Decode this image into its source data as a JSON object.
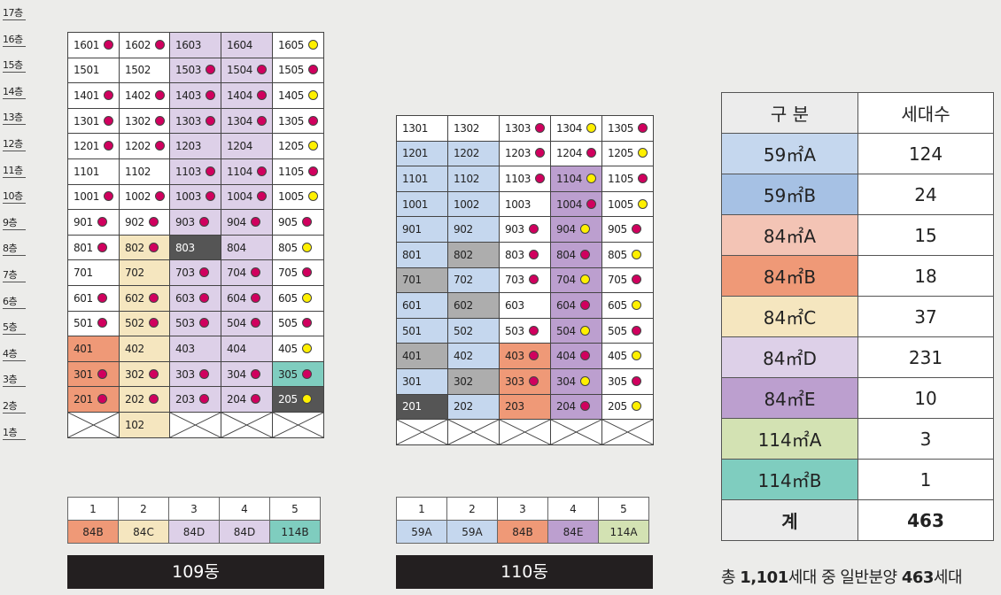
{
  "colors": {
    "59A": "#c5d7ee",
    "59B": "#a6c1e4",
    "84A": "#f3c4b5",
    "84B": "#ef9977",
    "84C": "#f5e6bf",
    "84D": "#ddd0e8",
    "84E": "#bc9fcf",
    "114A": "#d3e2b3",
    "114B": "#7fcdbf",
    "white": "#ffffff",
    "gray": "#adadad",
    "dark": "#555555",
    "header_bg": "#ececec"
  },
  "floors": [
    "17층",
    "16층",
    "15층",
    "14층",
    "13층",
    "12층",
    "11층",
    "10층",
    "9층",
    "8층",
    "7층",
    "6층",
    "5층",
    "4층",
    "3층",
    "2층",
    "1층"
  ],
  "building_109": {
    "name": "109동",
    "rows": [
      [
        [
          "1601",
          "white",
          "m"
        ],
        [
          "1602",
          "white",
          "m"
        ],
        [
          "1603",
          "84D",
          ""
        ],
        [
          "1604",
          "84D",
          ""
        ],
        [
          "1605",
          "white",
          "y"
        ]
      ],
      [
        [
          "1501",
          "white",
          ""
        ],
        [
          "1502",
          "white",
          ""
        ],
        [
          "1503",
          "84D",
          "m"
        ],
        [
          "1504",
          "84D",
          "m"
        ],
        [
          "1505",
          "white",
          "m"
        ]
      ],
      [
        [
          "1401",
          "white",
          "m"
        ],
        [
          "1402",
          "white",
          "m"
        ],
        [
          "1403",
          "84D",
          "m"
        ],
        [
          "1404",
          "84D",
          "m"
        ],
        [
          "1405",
          "white",
          "y"
        ]
      ],
      [
        [
          "1301",
          "white",
          "m"
        ],
        [
          "1302",
          "white",
          "m"
        ],
        [
          "1303",
          "84D",
          "m"
        ],
        [
          "1304",
          "84D",
          "m"
        ],
        [
          "1305",
          "white",
          "m"
        ]
      ],
      [
        [
          "1201",
          "white",
          "m"
        ],
        [
          "1202",
          "white",
          "m"
        ],
        [
          "1203",
          "84D",
          ""
        ],
        [
          "1204",
          "84D",
          ""
        ],
        [
          "1205",
          "white",
          "y"
        ]
      ],
      [
        [
          "1101",
          "white",
          ""
        ],
        [
          "1102",
          "white",
          ""
        ],
        [
          "1103",
          "84D",
          "m"
        ],
        [
          "1104",
          "84D",
          "m"
        ],
        [
          "1105",
          "white",
          "m"
        ]
      ],
      [
        [
          "1001",
          "white",
          "m"
        ],
        [
          "1002",
          "white",
          "m"
        ],
        [
          "1003",
          "84D",
          "m"
        ],
        [
          "1004",
          "84D",
          "m"
        ],
        [
          "1005",
          "white",
          "y"
        ]
      ],
      [
        [
          "901",
          "white",
          "m"
        ],
        [
          "902",
          "white",
          "m"
        ],
        [
          "903",
          "84D",
          "m"
        ],
        [
          "904",
          "84D",
          "m"
        ],
        [
          "905",
          "white",
          "m"
        ]
      ],
      [
        [
          "801",
          "white",
          "m"
        ],
        [
          "802",
          "84C",
          "m"
        ],
        [
          "803",
          "dark",
          ""
        ],
        [
          "804",
          "84D",
          ""
        ],
        [
          "805",
          "white",
          "y"
        ]
      ],
      [
        [
          "701",
          "white",
          ""
        ],
        [
          "702",
          "84C",
          ""
        ],
        [
          "703",
          "84D",
          "m"
        ],
        [
          "704",
          "84D",
          "m"
        ],
        [
          "705",
          "white",
          "m"
        ]
      ],
      [
        [
          "601",
          "white",
          "m"
        ],
        [
          "602",
          "84C",
          "m"
        ],
        [
          "603",
          "84D",
          "m"
        ],
        [
          "604",
          "84D",
          "m"
        ],
        [
          "605",
          "white",
          "y"
        ]
      ],
      [
        [
          "501",
          "white",
          "m"
        ],
        [
          "502",
          "84C",
          "m"
        ],
        [
          "503",
          "84D",
          "m"
        ],
        [
          "504",
          "84D",
          "m"
        ],
        [
          "505",
          "white",
          "m"
        ]
      ],
      [
        [
          "401",
          "84B",
          ""
        ],
        [
          "402",
          "84C",
          ""
        ],
        [
          "403",
          "84D",
          ""
        ],
        [
          "404",
          "84D",
          ""
        ],
        [
          "405",
          "white",
          "y"
        ]
      ],
      [
        [
          "301",
          "84B",
          "m"
        ],
        [
          "302",
          "84C",
          "m"
        ],
        [
          "303",
          "84D",
          "m"
        ],
        [
          "304",
          "84D",
          "m"
        ],
        [
          "305",
          "114B",
          "m"
        ]
      ],
      [
        [
          "201",
          "84B",
          "m"
        ],
        [
          "202",
          "84C",
          "m"
        ],
        [
          "203",
          "84D",
          "m"
        ],
        [
          "204",
          "84D",
          "m"
        ],
        [
          "205",
          "dark",
          "y"
        ]
      ],
      [
        [
          "",
          "white",
          "x"
        ],
        [
          "102",
          "84C",
          ""
        ],
        [
          "",
          "white",
          "x"
        ],
        [
          "",
          "white",
          "x"
        ],
        [
          "",
          "white",
          "x"
        ]
      ]
    ],
    "legend_numbers": [
      "1",
      "2",
      "3",
      "4",
      "5"
    ],
    "legend_types": [
      [
        "84B",
        "84B"
      ],
      [
        "84C",
        "84C"
      ],
      [
        "84D",
        "84D"
      ],
      [
        "84D",
        "84D"
      ],
      [
        "114B",
        "114B"
      ]
    ]
  },
  "building_110": {
    "name": "110동",
    "rows": [
      [
        [
          "1301",
          "white",
          ""
        ],
        [
          "1302",
          "white",
          ""
        ],
        [
          "1303",
          "white",
          "m"
        ],
        [
          "1304",
          "white",
          "y"
        ],
        [
          "1305",
          "white",
          "m"
        ]
      ],
      [
        [
          "1201",
          "59A",
          ""
        ],
        [
          "1202",
          "59A",
          ""
        ],
        [
          "1203",
          "white",
          "m"
        ],
        [
          "1204",
          "white",
          "m"
        ],
        [
          "1205",
          "white",
          "y"
        ]
      ],
      [
        [
          "1101",
          "59A",
          ""
        ],
        [
          "1102",
          "59A",
          ""
        ],
        [
          "1103",
          "white",
          "m"
        ],
        [
          "1104",
          "84E",
          "y"
        ],
        [
          "1105",
          "white",
          "m"
        ]
      ],
      [
        [
          "1001",
          "59A",
          ""
        ],
        [
          "1002",
          "59A",
          ""
        ],
        [
          "1003",
          "white",
          ""
        ],
        [
          "1004",
          "84E",
          "m"
        ],
        [
          "1005",
          "white",
          "y"
        ]
      ],
      [
        [
          "901",
          "59A",
          ""
        ],
        [
          "902",
          "59A",
          ""
        ],
        [
          "903",
          "white",
          "m"
        ],
        [
          "904",
          "84E",
          "y"
        ],
        [
          "905",
          "white",
          "m"
        ]
      ],
      [
        [
          "801",
          "59A",
          ""
        ],
        [
          "802",
          "gray",
          ""
        ],
        [
          "803",
          "white",
          "m"
        ],
        [
          "804",
          "84E",
          "m"
        ],
        [
          "805",
          "white",
          "y"
        ]
      ],
      [
        [
          "701",
          "gray",
          ""
        ],
        [
          "702",
          "59A",
          ""
        ],
        [
          "703",
          "white",
          "m"
        ],
        [
          "704",
          "84E",
          "y"
        ],
        [
          "705",
          "white",
          "m"
        ]
      ],
      [
        [
          "601",
          "59A",
          ""
        ],
        [
          "602",
          "gray",
          ""
        ],
        [
          "603",
          "white",
          ""
        ],
        [
          "604",
          "84E",
          "m"
        ],
        [
          "605",
          "white",
          "y"
        ]
      ],
      [
        [
          "501",
          "59A",
          ""
        ],
        [
          "502",
          "59A",
          ""
        ],
        [
          "503",
          "white",
          "m"
        ],
        [
          "504",
          "84E",
          "y"
        ],
        [
          "505",
          "white",
          "m"
        ]
      ],
      [
        [
          "401",
          "gray",
          ""
        ],
        [
          "402",
          "59A",
          ""
        ],
        [
          "403",
          "84B",
          "m"
        ],
        [
          "404",
          "84E",
          "m"
        ],
        [
          "405",
          "white",
          "y"
        ]
      ],
      [
        [
          "301",
          "59A",
          ""
        ],
        [
          "302",
          "gray",
          ""
        ],
        [
          "303",
          "84B",
          "m"
        ],
        [
          "304",
          "84E",
          "y"
        ],
        [
          "305",
          "white",
          "m"
        ]
      ],
      [
        [
          "201",
          "dark",
          ""
        ],
        [
          "202",
          "59A",
          ""
        ],
        [
          "203",
          "84B",
          ""
        ],
        [
          "204",
          "84E",
          "m"
        ],
        [
          "205",
          "white",
          "y"
        ]
      ],
      [
        [
          "",
          "white",
          "x"
        ],
        [
          "",
          "white",
          "x"
        ],
        [
          "",
          "white",
          "x"
        ],
        [
          "",
          "white",
          "x"
        ],
        [
          "",
          "white",
          "x"
        ]
      ]
    ],
    "legend_numbers": [
      "1",
      "2",
      "3",
      "4",
      "5"
    ],
    "legend_types": [
      [
        "59A",
        "59A"
      ],
      [
        "59A",
        "59A"
      ],
      [
        "84B",
        "84B"
      ],
      [
        "84E",
        "84E"
      ],
      [
        "114A",
        "114A"
      ]
    ]
  },
  "summary": {
    "header": [
      "구 분",
      "세대수"
    ],
    "rows": [
      {
        "type": "59㎡A",
        "count": "124",
        "color": "59A"
      },
      {
        "type": "59㎡B",
        "count": "24",
        "color": "59B"
      },
      {
        "type": "84㎡A",
        "count": "15",
        "color": "84A"
      },
      {
        "type": "84㎡B",
        "count": "18",
        "color": "84B"
      },
      {
        "type": "84㎡C",
        "count": "37",
        "color": "84C"
      },
      {
        "type": "84㎡D",
        "count": "231",
        "color": "84D"
      },
      {
        "type": "84㎡E",
        "count": "10",
        "color": "84E"
      },
      {
        "type": "114㎡A",
        "count": "3",
        "color": "114A"
      },
      {
        "type": "114㎡B",
        "count": "1",
        "color": "114B"
      }
    ],
    "total_label": "계",
    "total_count": "463"
  },
  "footnote": {
    "p1": "총 ",
    "total_units": "1,101",
    "p2": "세대 중 일반분양 ",
    "general_units": "463",
    "p3": "세대"
  }
}
